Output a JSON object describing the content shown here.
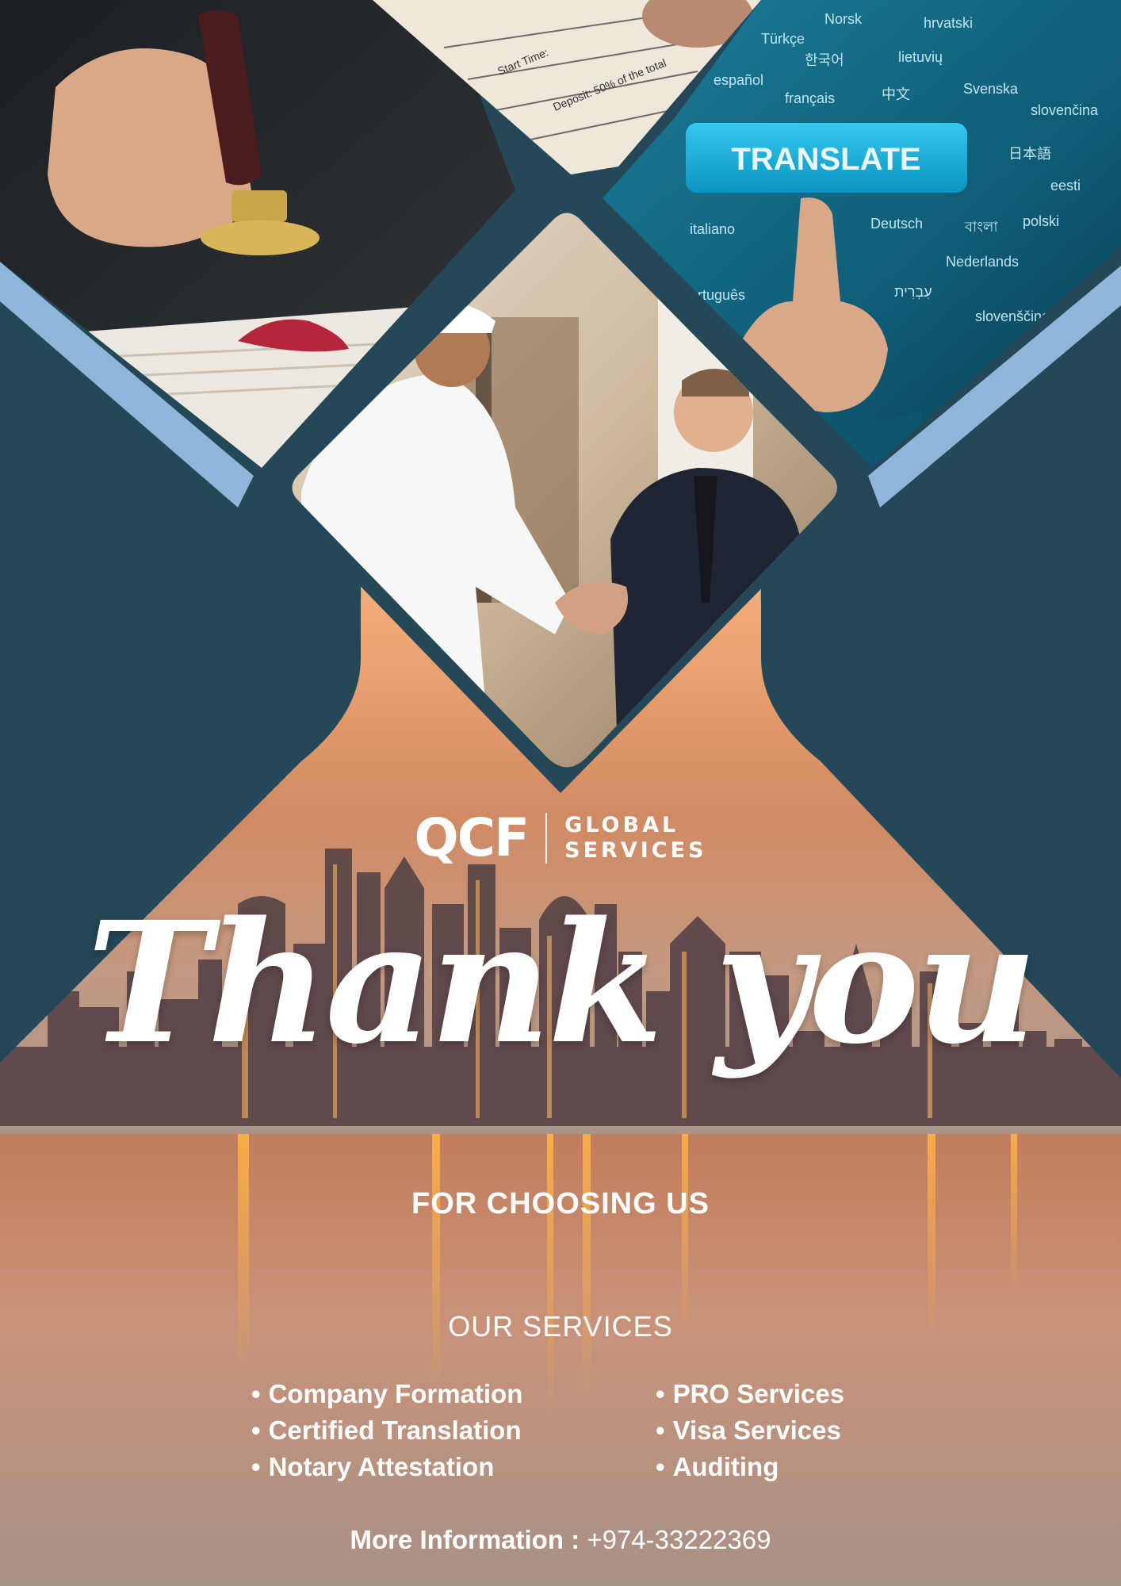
{
  "logo": {
    "mark": "QCF",
    "line1": "GLOBAL",
    "line2": "SERVICES"
  },
  "headline": "Thank you",
  "subtitle": "FOR CHOOSING US",
  "services": {
    "heading": "OUR SERVICES",
    "left": [
      "Company Formation",
      "Certified Translation",
      "Notary Attestation"
    ],
    "right": [
      "PRO Services",
      "Visa Services",
      "Auditing"
    ]
  },
  "contact": {
    "label": "More Information :",
    "phone": "+974-33222369"
  },
  "translate_photo": {
    "button": "TRANSLATE",
    "languages": [
      "Norsk",
      "hrvatski",
      "Türkçe",
      "한국어",
      "lietuvių",
      "español",
      "français",
      "中文",
      "Svenska",
      "slovenčina",
      "日本語",
      "eesti",
      "italiano",
      "Deutsch",
      "বাংলা",
      "polski",
      "Nederlands",
      "עִבְרִית",
      "português",
      "slovenščina"
    ]
  },
  "colors": {
    "frame": "#244857",
    "accent_stripe": "#8fb6d8",
    "text": "#ffffff"
  },
  "icons": [
    "qcf-logo-icon"
  ]
}
